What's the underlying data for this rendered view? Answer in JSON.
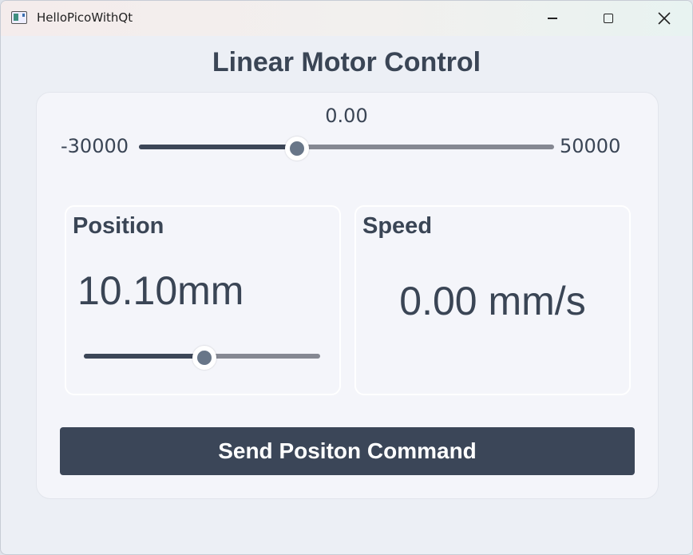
{
  "window": {
    "title": "HelloPicoWithQt"
  },
  "page": {
    "title": "Linear Motor Control"
  },
  "main_slider": {
    "value_text": "0.00",
    "min_label": "-30000",
    "max_label": "50000",
    "fraction": 0.38
  },
  "position": {
    "label": "Position",
    "value": "10.10mm",
    "slider_fraction": 0.51
  },
  "speed": {
    "label": "Speed",
    "value": "0.00 mm/s"
  },
  "actions": {
    "send_label": "Send Positon Command"
  },
  "colors": {
    "accent": "#3b4658",
    "track": "#858892",
    "handle": "#687688",
    "card": "#f4f5fa",
    "background": "#eceff5"
  },
  "icons": {
    "app": "app-icon",
    "minimize": "minimize-icon",
    "maximize": "maximize-icon",
    "close": "close-icon"
  }
}
